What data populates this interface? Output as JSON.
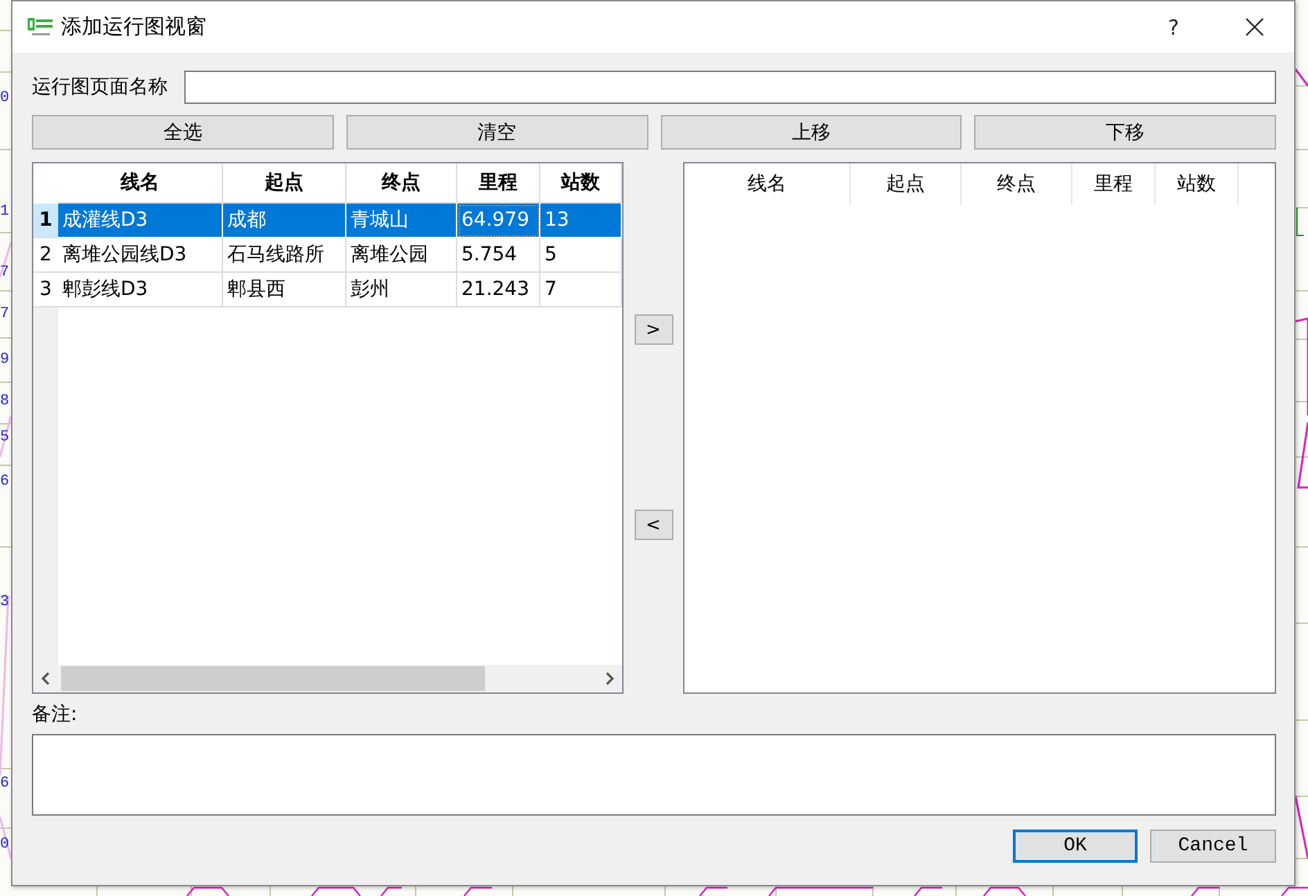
{
  "background": {
    "left_labels": [
      "0",
      "1",
      "7",
      "7",
      "9",
      "8",
      "5",
      "6",
      "3",
      "6",
      "0"
    ]
  },
  "window": {
    "title": "添加运行图视窗",
    "help": "?"
  },
  "page_name": {
    "label": "运行图页面名称"
  },
  "toolbar_buttons": [
    "全选",
    "清空",
    "上移",
    "下移"
  ],
  "source_table": {
    "columns": [
      "线名",
      "起点",
      "终点",
      "里程",
      "站数"
    ],
    "rows": [
      {
        "number": "1",
        "selected": true,
        "cells": [
          {
            "text": "成灌线D3",
            "focused": false
          },
          {
            "text": "成都",
            "focused": false
          },
          {
            "text": "青城山",
            "focused": false
          },
          {
            "text": "64.979",
            "focused": true
          },
          {
            "text": "13",
            "focused": false
          }
        ]
      },
      {
        "number": "2",
        "selected": false,
        "cells": [
          {
            "text": "离堆公园线D3",
            "focused": false
          },
          {
            "text": "石马线路所",
            "focused": false
          },
          {
            "text": "离堆公园",
            "focused": false
          },
          {
            "text": "5.754",
            "focused": false
          },
          {
            "text": "5",
            "focused": false
          }
        ]
      },
      {
        "number": "3",
        "selected": false,
        "cells": [
          {
            "text": "郫彭线D3",
            "focused": false
          },
          {
            "text": "郫县西",
            "focused": false
          },
          {
            "text": "彭州",
            "focused": false
          },
          {
            "text": "21.243",
            "focused": false
          },
          {
            "text": "7",
            "focused": false
          }
        ]
      }
    ]
  },
  "move_buttons": [
    ">",
    "<"
  ],
  "target_table": {
    "columns": [
      "线名",
      "起点",
      "终点",
      "里程",
      "站数"
    ]
  },
  "remark": {
    "label": "备注:"
  },
  "dialog_buttons": [
    {
      "label": "OK",
      "default": true
    },
    {
      "label": "Cancel",
      "default": false
    }
  ]
}
